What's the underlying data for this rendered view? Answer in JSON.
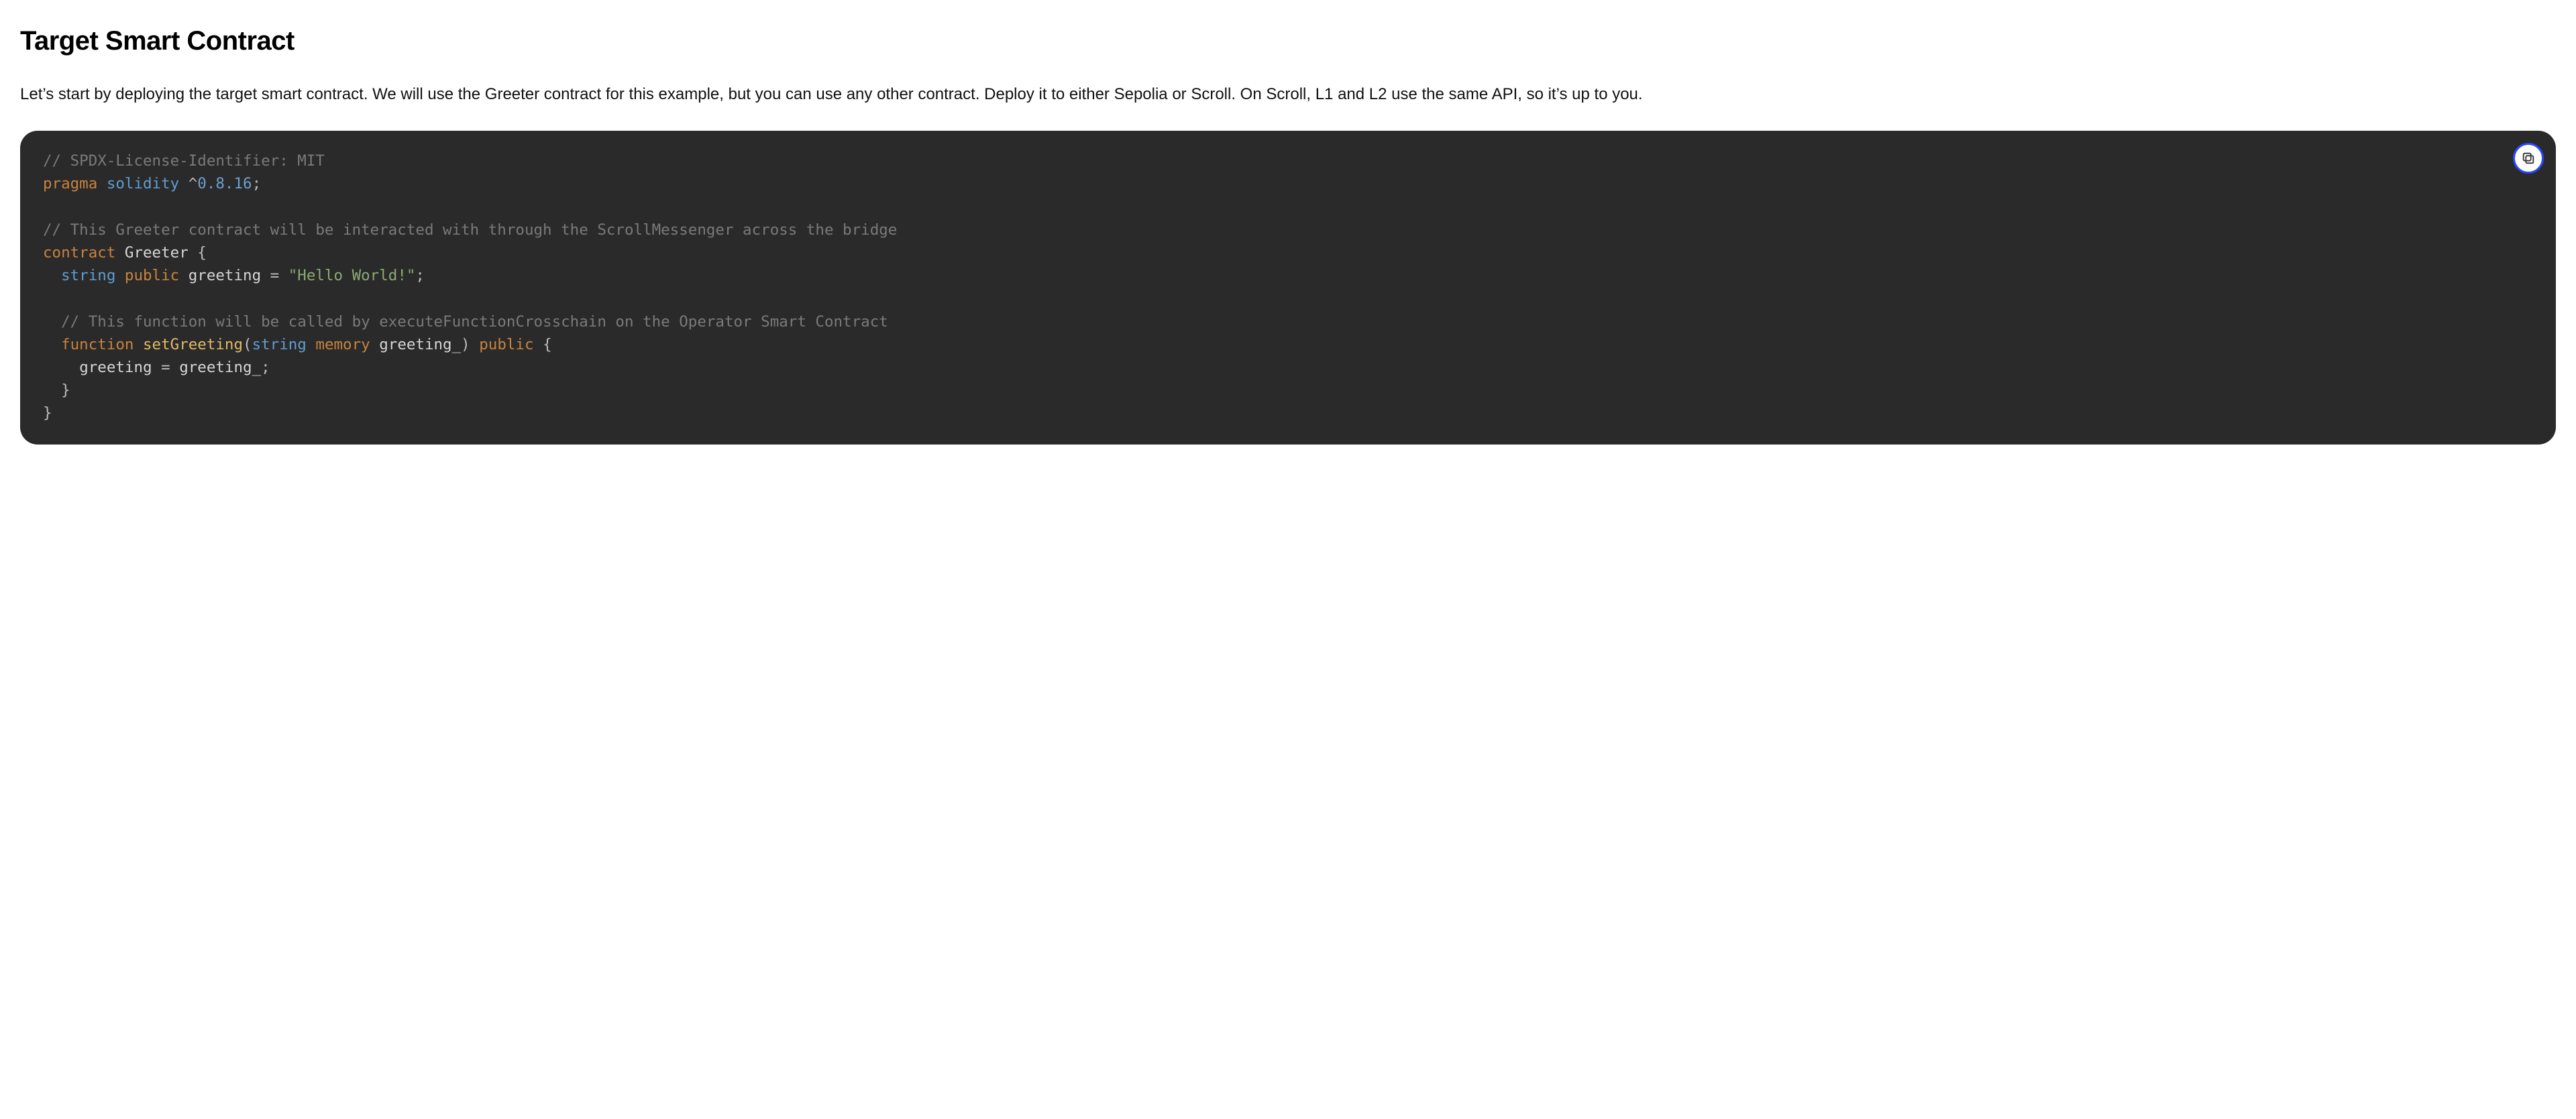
{
  "section": {
    "heading": "Target Smart Contract",
    "paragraph": "Let’s start by deploying the target smart contract. We will use the Greeter contract for this example, but you can use any other contract. Deploy it to either Sepolia or Scroll. On Scroll, L1 and L2 use the same API, so it’s up to you."
  },
  "code": {
    "language": "solidity",
    "c1": "// SPDX-License-Identifier: MIT",
    "kw_pragma": "pragma",
    "kw_solidity": "solidity",
    "ver_caret": "^",
    "ver_num": "0.8.16",
    "semi": ";",
    "c2": "// This Greeter contract will be interacted with through the ScrollMessenger across the bridge",
    "kw_contract": "contract",
    "name_contract": "Greeter",
    "brace_open": "{",
    "indent1": "  ",
    "ty_string": "string",
    "kw_public": "public",
    "var_greeting": "greeting",
    "eq": "=",
    "str_hello": "\"Hello World!\"",
    "c3": "// This function will be called by executeFunctionCrosschain on the Operator Smart Contract",
    "kw_function": "function",
    "fn_name": "setGreeting",
    "paren_open": "(",
    "kw_memory": "memory",
    "param_name": "greeting_",
    "paren_close": ")",
    "indent2": "    ",
    "assign_lhs": "greeting",
    "assign_rhs": "greeting_",
    "brace_close": "}",
    "copy_label": "Copy code"
  }
}
